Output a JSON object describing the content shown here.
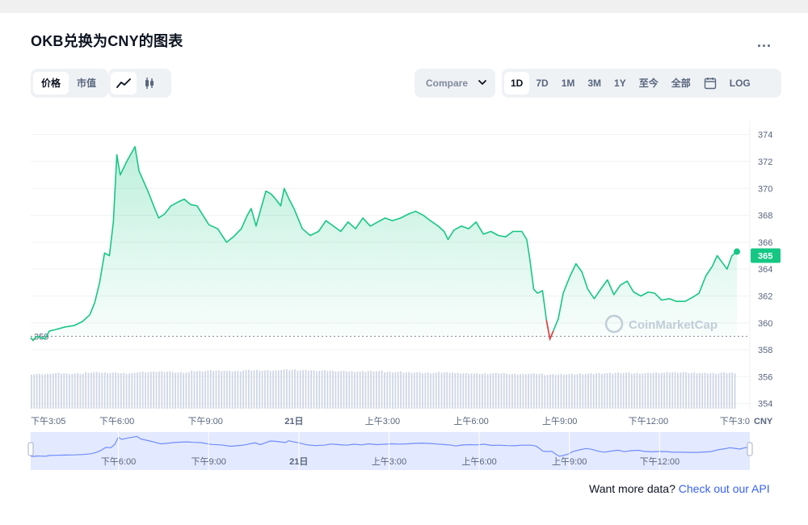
{
  "header": {
    "title": "OKB兑换为CNY的图表",
    "more_label": "..."
  },
  "toolbar": {
    "type_tabs": [
      {
        "label": "价格",
        "active": true
      },
      {
        "label": "市值",
        "active": false
      }
    ],
    "view_icons": [
      {
        "icon": "line-chart-icon",
        "active": true
      },
      {
        "icon": "candlestick-icon",
        "active": false
      }
    ],
    "compare_label": "Compare",
    "range_tabs": [
      {
        "label": "1D",
        "active": true
      },
      {
        "label": "7D",
        "active": false
      },
      {
        "label": "1M",
        "active": false
      },
      {
        "label": "3M",
        "active": false
      },
      {
        "label": "1Y",
        "active": false
      },
      {
        "label": "至今",
        "active": false
      },
      {
        "label": "全部",
        "active": false
      }
    ],
    "calendar_icon": "calendar-icon",
    "log_label": "LOG"
  },
  "chart_data": {
    "type": "area",
    "currency": "CNY",
    "y_ticks": [
      374,
      372,
      370,
      368,
      366,
      364,
      362,
      360,
      358,
      356,
      354
    ],
    "ylim": [
      353.5,
      375
    ],
    "reference_value": 359,
    "reference_label": "359",
    "current_value": 365,
    "current_label": "365",
    "x_ticks": [
      {
        "label": "下午3:05",
        "t": 0
      },
      {
        "label": "下午6:00",
        "t": 175
      },
      {
        "label": "下午9:00",
        "t": 355
      },
      {
        "label": "21日",
        "t": 535
      },
      {
        "label": "上午3:00",
        "t": 715
      },
      {
        "label": "上午6:00",
        "t": 895
      },
      {
        "label": "上午9:00",
        "t": 1075
      },
      {
        "label": "下午12:00",
        "t": 1255
      },
      {
        "label": "下午3:0",
        "t": 1435
      }
    ],
    "xlim": [
      0,
      1435
    ],
    "series": [
      {
        "points": [
          [
            0,
            358.9
          ],
          [
            5,
            358.7
          ],
          [
            12,
            359.0
          ],
          [
            22,
            358.9
          ],
          [
            28,
            358.8
          ],
          [
            32,
            359.0
          ],
          [
            38,
            359.4
          ],
          [
            50,
            359.5
          ],
          [
            70,
            359.7
          ],
          [
            88,
            359.8
          ],
          [
            105,
            360.1
          ],
          [
            120,
            360.6
          ],
          [
            130,
            361.5
          ],
          [
            140,
            363.0
          ],
          [
            150,
            365.2
          ],
          [
            160,
            365.0
          ],
          [
            168,
            367.5
          ],
          [
            175,
            372.5
          ],
          [
            182,
            371.0
          ],
          [
            195,
            372.0
          ],
          [
            212,
            373.1
          ],
          [
            220,
            371.3
          ],
          [
            238,
            369.8
          ],
          [
            252,
            368.5
          ],
          [
            260,
            367.8
          ],
          [
            272,
            368.1
          ],
          [
            285,
            368.7
          ],
          [
            300,
            369.0
          ],
          [
            312,
            369.2
          ],
          [
            325,
            368.8
          ],
          [
            338,
            368.7
          ],
          [
            350,
            368.0
          ],
          [
            362,
            367.3
          ],
          [
            380,
            367.0
          ],
          [
            398,
            366.0
          ],
          [
            412,
            366.4
          ],
          [
            428,
            367.0
          ],
          [
            440,
            368.0
          ],
          [
            448,
            368.5
          ],
          [
            458,
            367.2
          ],
          [
            468,
            368.5
          ],
          [
            478,
            369.8
          ],
          [
            488,
            369.6
          ],
          [
            498,
            369.2
          ],
          [
            508,
            368.7
          ],
          [
            515,
            370.0
          ],
          [
            525,
            369.2
          ],
          [
            535,
            368.5
          ],
          [
            552,
            367.0
          ],
          [
            568,
            366.5
          ],
          [
            585,
            366.8
          ],
          [
            600,
            367.6
          ],
          [
            615,
            367.2
          ],
          [
            630,
            366.8
          ],
          [
            645,
            367.5
          ],
          [
            660,
            367.0
          ],
          [
            675,
            367.8
          ],
          [
            690,
            367.2
          ],
          [
            705,
            367.5
          ],
          [
            720,
            367.8
          ],
          [
            735,
            367.6
          ],
          [
            752,
            367.8
          ],
          [
            768,
            368.1
          ],
          [
            782,
            368.3
          ],
          [
            798,
            368.0
          ],
          [
            812,
            367.6
          ],
          [
            828,
            367.2
          ],
          [
            840,
            366.8
          ],
          [
            848,
            366.2
          ],
          [
            860,
            366.9
          ],
          [
            875,
            367.2
          ],
          [
            890,
            367.0
          ],
          [
            905,
            367.5
          ],
          [
            920,
            366.6
          ],
          [
            935,
            366.8
          ],
          [
            950,
            366.5
          ],
          [
            965,
            366.4
          ],
          [
            980,
            366.8
          ],
          [
            998,
            366.8
          ],
          [
            1008,
            366.2
          ],
          [
            1014,
            364.8
          ],
          [
            1022,
            362.5
          ],
          [
            1030,
            362.2
          ],
          [
            1040,
            362.4
          ],
          [
            1048,
            360.2
          ],
          [
            1055,
            358.8
          ],
          [
            1062,
            359.4
          ],
          [
            1072,
            360.3
          ],
          [
            1082,
            362.2
          ],
          [
            1095,
            363.4
          ],
          [
            1108,
            364.4
          ],
          [
            1120,
            363.8
          ],
          [
            1132,
            362.5
          ],
          [
            1145,
            361.8
          ],
          [
            1160,
            362.6
          ],
          [
            1172,
            363.2
          ],
          [
            1185,
            362.1
          ],
          [
            1198,
            362.8
          ],
          [
            1212,
            363.1
          ],
          [
            1225,
            362.3
          ],
          [
            1240,
            362.0
          ],
          [
            1255,
            362.3
          ],
          [
            1268,
            362.2
          ],
          [
            1282,
            361.7
          ],
          [
            1298,
            361.8
          ],
          [
            1312,
            361.6
          ],
          [
            1330,
            361.6
          ],
          [
            1345,
            361.9
          ],
          [
            1358,
            362.2
          ],
          [
            1372,
            363.5
          ],
          [
            1385,
            364.2
          ],
          [
            1395,
            365.0
          ],
          [
            1405,
            364.5
          ],
          [
            1415,
            364.0
          ],
          [
            1425,
            365.0
          ],
          [
            1435,
            365.3
          ]
        ]
      }
    ],
    "volume": [
      0.78,
      0.8,
      0.79,
      0.82,
      0.81,
      0.8,
      0.83,
      0.84,
      0.82,
      0.85,
      0.86,
      0.85,
      0.87,
      0.86,
      0.88,
      0.87,
      0.86,
      0.85,
      0.84,
      0.85,
      0.83,
      0.82,
      0.81,
      0.82,
      0.8,
      0.79,
      0.8,
      0.78,
      0.79,
      0.77,
      0.78,
      0.79,
      0.8,
      0.81,
      0.8,
      0.81,
      0.82,
      0.81,
      0.8,
      0.81
    ],
    "navigator": {
      "x_ticks": [
        {
          "label": "下午6:00",
          "t": 175
        },
        {
          "label": "下午9:00",
          "t": 355
        },
        {
          "label": "21日",
          "t": 535
        },
        {
          "label": "上午3:00",
          "t": 715
        },
        {
          "label": "上午6:00",
          "t": 895
        },
        {
          "label": "上午9:00",
          "t": 1075
        },
        {
          "label": "下午12:00",
          "t": 1255
        }
      ]
    },
    "watermark": "CoinMarketCap"
  },
  "colors": {
    "up_line": "#16c784",
    "down_line": "#ea3943",
    "grid": "#eff2f5",
    "nav_fill": "#e3e9fe",
    "nav_line": "#6f8dfb",
    "volume": "#cfd6e4",
    "link": "#3861fb"
  },
  "footer": {
    "prefix": "Want more data?",
    "link_text": "Check out our API"
  }
}
